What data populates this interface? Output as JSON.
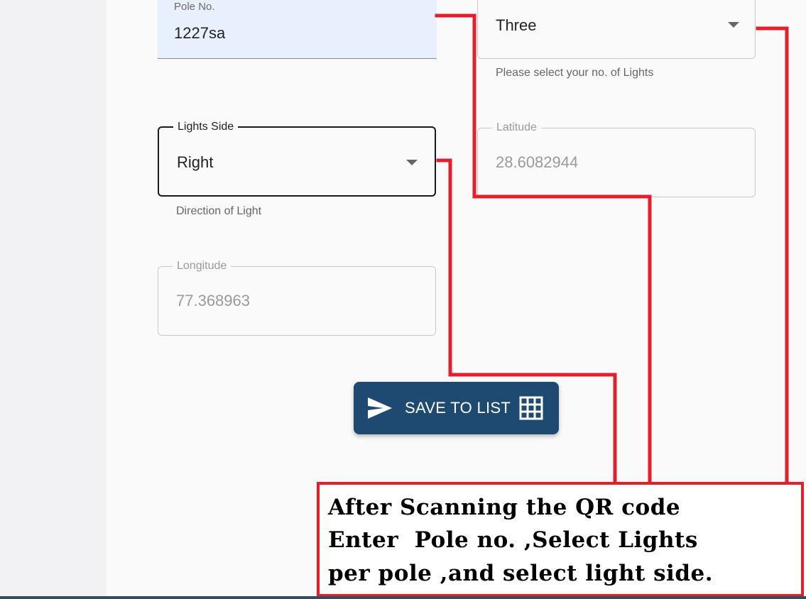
{
  "form": {
    "pole_no": {
      "label": "Pole No.",
      "value": "1227sa"
    },
    "lights_count": {
      "value": "Three",
      "helper": "Please select your no. of Lights"
    },
    "lights_side": {
      "label": "Lights Side",
      "value": "Right",
      "helper": "Direction of Light"
    },
    "latitude": {
      "label": "Latitude",
      "value": "28.6082944"
    },
    "longitude": {
      "label": "Longitude",
      "value": "77.368963"
    }
  },
  "save_button": {
    "label": "SAVE TO LIST",
    "icons": [
      "send-icon",
      "grid-icon"
    ],
    "color": "#1e4a72"
  },
  "annotation": {
    "lines": [
      "After Scanning the QR code",
      "Enter  Pole no. ,Select Lights",
      "per pole ,and select light side."
    ],
    "color": "#e41e2b"
  }
}
